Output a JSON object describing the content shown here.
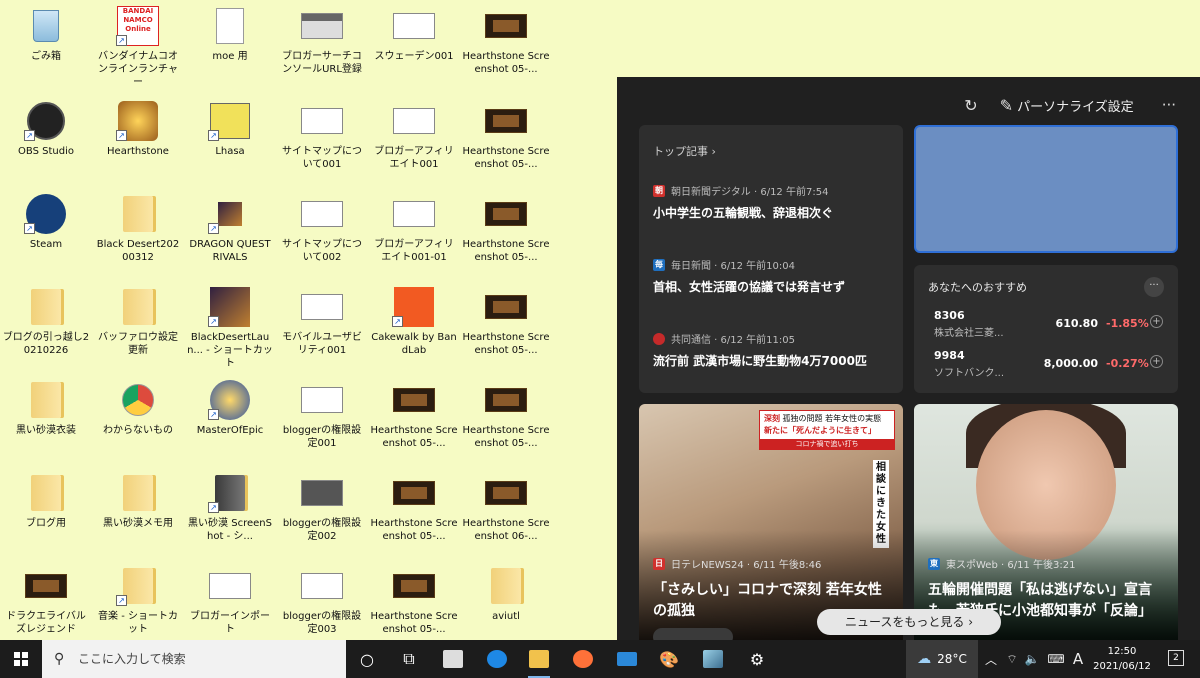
{
  "desktop": {
    "icons": [
      {
        "label": "ごみ箱",
        "icon": "recycle-bin-icon"
      },
      {
        "label": "バンダイナムコオンラインランチャー",
        "icon": "bandai-namco-online-icon",
        "logo_text": "BANDAI NAMCO Online"
      },
      {
        "label": "moe 用",
        "icon": "text-document-icon"
      },
      {
        "label": "ブロガーサーチコンソールURL登録",
        "icon": "image-file-icon"
      },
      {
        "label": "スウェーデン001",
        "icon": "image-file-icon"
      },
      {
        "label": "Hearthstone Screenshot 05-...",
        "icon": "screenshot-file-icon"
      },
      {
        "label": "OBS Studio",
        "icon": "obs-studio-icon"
      },
      {
        "label": "Hearthstone",
        "icon": "hearthstone-icon"
      },
      {
        "label": "Lhasa",
        "icon": "lhasa-icon"
      },
      {
        "label": "サイトマップについて001",
        "icon": "image-file-icon"
      },
      {
        "label": "ブロガーアフィリエイト001",
        "icon": "image-file-icon"
      },
      {
        "label": "Hearthstone Screenshot 05-...",
        "icon": "screenshot-file-icon"
      },
      {
        "label": "Steam",
        "icon": "steam-icon"
      },
      {
        "label": "Black Desert20200312",
        "icon": "folder-icon"
      },
      {
        "label": "DRAGON QUEST RIVALS",
        "icon": "dragon-quest-rivals-icon"
      },
      {
        "label": "サイトマップについて002",
        "icon": "image-file-icon"
      },
      {
        "label": "ブロガーアフィリエイト001-01",
        "icon": "image-file-icon"
      },
      {
        "label": "Hearthstone Screenshot 05-...",
        "icon": "screenshot-file-icon"
      },
      {
        "label": "ブログの引っ越し20210226",
        "icon": "folder-icon"
      },
      {
        "label": "バッファロウ設定更新",
        "icon": "folder-icon"
      },
      {
        "label": "BlackDesertLaun... - ショートカット",
        "icon": "black-desert-launcher-icon"
      },
      {
        "label": "モバイルユーザビリティ001",
        "icon": "image-file-icon"
      },
      {
        "label": "Cakewalk by BandLab",
        "icon": "cakewalk-icon"
      },
      {
        "label": "Hearthstone Screenshot 05-...",
        "icon": "screenshot-file-icon"
      },
      {
        "label": "黒い砂漠衣装",
        "icon": "folder-icon"
      },
      {
        "label": "わからないもの",
        "icon": "chrome-icon"
      },
      {
        "label": "MasterOfEpic",
        "icon": "master-of-epic-icon"
      },
      {
        "label": "bloggerの権限設定001",
        "icon": "image-file-icon"
      },
      {
        "label": "Hearthstone Screenshot 05-...",
        "icon": "screenshot-file-icon"
      },
      {
        "label": "Hearthstone Screenshot 05-...",
        "icon": "screenshot-file-icon"
      },
      {
        "label": "ブログ用",
        "icon": "folder-icon"
      },
      {
        "label": "黒い砂漠メモ用",
        "icon": "folder-icon"
      },
      {
        "label": "黒い砂漠 ScreenShot - シ...",
        "icon": "folder-shortcut-icon"
      },
      {
        "label": "bloggerの権限設定002",
        "icon": "image-file-icon"
      },
      {
        "label": "Hearthstone Screenshot 05-...",
        "icon": "screenshot-file-icon"
      },
      {
        "label": "Hearthstone Screenshot 06-...",
        "icon": "screenshot-file-icon"
      },
      {
        "label": "ドラクエライバルズレジェンド",
        "icon": "screenshot-file-icon"
      },
      {
        "label": "音楽 - ショートカット",
        "icon": "folder-shortcut-icon"
      },
      {
        "label": "ブロガーインポート",
        "icon": "image-file-icon"
      },
      {
        "label": "bloggerの権限設定003",
        "icon": "image-file-icon"
      },
      {
        "label": "Hearthstone Screenshot 05-...",
        "icon": "screenshot-file-icon"
      },
      {
        "label": "aviutl",
        "icon": "folder-icon"
      }
    ]
  },
  "news_panel": {
    "personalize_label": "パーソナライズ設定",
    "refresh_icon": "refresh-icon",
    "edit_icon": "pencil-icon",
    "more_icon": "more-icon",
    "more_glyph": "···",
    "top_stories": {
      "header": "トップ記事 ›",
      "items": [
        {
          "logo": "朝",
          "logo_color": "#d0312d",
          "source": "朝日新聞デジタル · 6/12 午前7:54",
          "headline": "小中学生の五輪観戦、辞退相次ぐ"
        },
        {
          "logo": "毎",
          "logo_color": "#1f6fbf",
          "source": "毎日新聞 · 6/12 午前10:04",
          "headline": "首相、女性活躍の協議では発言せず"
        },
        {
          "logo": "",
          "logo_color": "#c52a2a",
          "source": "共同通信 · 6/12 午前11:05",
          "headline": "流行前 武漢市場に野生動物4万7000匹"
        }
      ]
    },
    "recommend": {
      "header": "あなたへのおすすめ",
      "stocks": [
        {
          "code": "8306",
          "name": "株式会社三菱...",
          "price": "610.80",
          "change": "-1.85%"
        },
        {
          "code": "9984",
          "name": "ソフトバンク...",
          "price": "8,000.00",
          "change": "-0.27%"
        }
      ]
    },
    "photo_cards": [
      {
        "logo": "日",
        "logo_color": "#d0312d",
        "source": "日テレNEWS24 · 6/11 午後8:46",
        "headline": "「さみしい」コロナで深刻 若年女性の孤独",
        "caption_tag": "深刻",
        "caption_line1": "孤独の問題 若年女性の実態",
        "caption_line2": "新たに「死んだように生きて」",
        "caption_bar": "コロナ禍で追い打ち",
        "vertical_text": "相談にきた女性"
      },
      {
        "logo": "東",
        "logo_color": "#1f6fbf",
        "source": "東スポWeb · 6/11 午後3:21",
        "headline": "五輪開催問題「私は逃げない」宣言も…若狭氏に小池都知事が「反論」"
      }
    ],
    "more_news_label": "ニュースをもっと見る ›"
  },
  "taskbar": {
    "search_placeholder": "ここに入力して検索",
    "weather_temp": "28°C",
    "ime_label": "A",
    "time": "12:50",
    "date": "2021/06/12",
    "notification_count": "2",
    "colors": {
      "accent": "#7fb6ea",
      "edge": "#1e88e5",
      "firefox": "#ff7139"
    }
  }
}
